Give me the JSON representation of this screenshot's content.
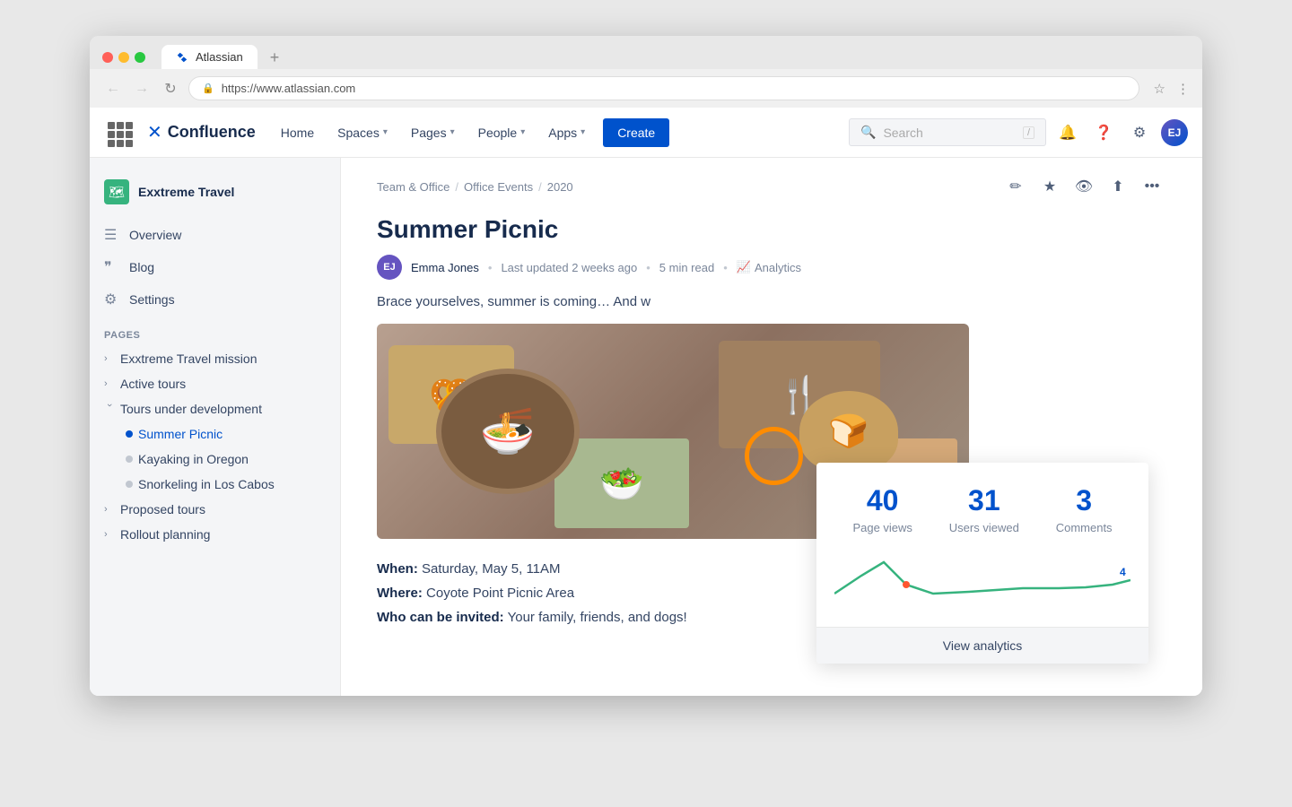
{
  "browser": {
    "tab_title": "Atlassian",
    "url": "https://www.atlassian.com",
    "tab_add": "+",
    "nav_back": "←",
    "nav_forward": "→",
    "nav_refresh": "↻"
  },
  "topnav": {
    "logo_text": "Confluence",
    "home": "Home",
    "spaces": "Spaces",
    "pages": "Pages",
    "people": "People",
    "apps": "Apps",
    "create": "Create",
    "search_placeholder": "Search"
  },
  "sidebar": {
    "space_name": "Exxtreme Travel",
    "nav": [
      {
        "id": "overview",
        "label": "Overview",
        "icon": "☰"
      },
      {
        "id": "blog",
        "label": "Blog",
        "icon": "❝"
      },
      {
        "id": "settings",
        "label": "Settings",
        "icon": "⚙"
      }
    ],
    "pages_section": "PAGES",
    "pages": [
      {
        "id": "mission",
        "label": "Exxtreme Travel mission",
        "indent": 0,
        "type": "chevron"
      },
      {
        "id": "active-tours",
        "label": "Active tours",
        "indent": 0,
        "type": "chevron"
      },
      {
        "id": "tours-under",
        "label": "Tours under development",
        "indent": 0,
        "type": "chevron-open"
      },
      {
        "id": "summer-picnic",
        "label": "Summer Picnic",
        "indent": 1,
        "type": "bullet",
        "active": true
      },
      {
        "id": "kayaking",
        "label": "Kayaking in Oregon",
        "indent": 1,
        "type": "bullet"
      },
      {
        "id": "snorkeling",
        "label": "Snorkeling in Los Cabos",
        "indent": 1,
        "type": "bullet"
      },
      {
        "id": "proposed",
        "label": "Proposed tours",
        "indent": 0,
        "type": "chevron"
      },
      {
        "id": "rollout",
        "label": "Rollout planning",
        "indent": 0,
        "type": "chevron"
      }
    ]
  },
  "breadcrumb": {
    "items": [
      "Team & Office",
      "Office Events",
      "2020"
    ]
  },
  "page": {
    "title": "Summer Picnic",
    "author": {
      "name": "Emma Jones",
      "updated": "Last updated 2 weeks ago",
      "read_time": "5 min read"
    },
    "analytics_label": "Analytics",
    "intro": "Brace yourselves, summer is coming… And w",
    "when_label": "When:",
    "when_value": "Saturday, May 5, 11AM",
    "where_label": "Where:",
    "where_value": "Coyote Point Picnic Area",
    "who_label": "Who can be invited:",
    "who_value": "Your family, friends, and dogs!"
  },
  "analytics_popup": {
    "page_views_value": "40",
    "page_views_label": "Page views",
    "users_viewed_value": "31",
    "users_viewed_label": "Users viewed",
    "comments_value": "3",
    "comments_label": "Comments",
    "view_btn": "View analytics",
    "chart_end_value": "4"
  },
  "toolbar": {
    "edit": "✏",
    "star": "★",
    "watch": "👁",
    "share": "⬆",
    "more": "…"
  }
}
